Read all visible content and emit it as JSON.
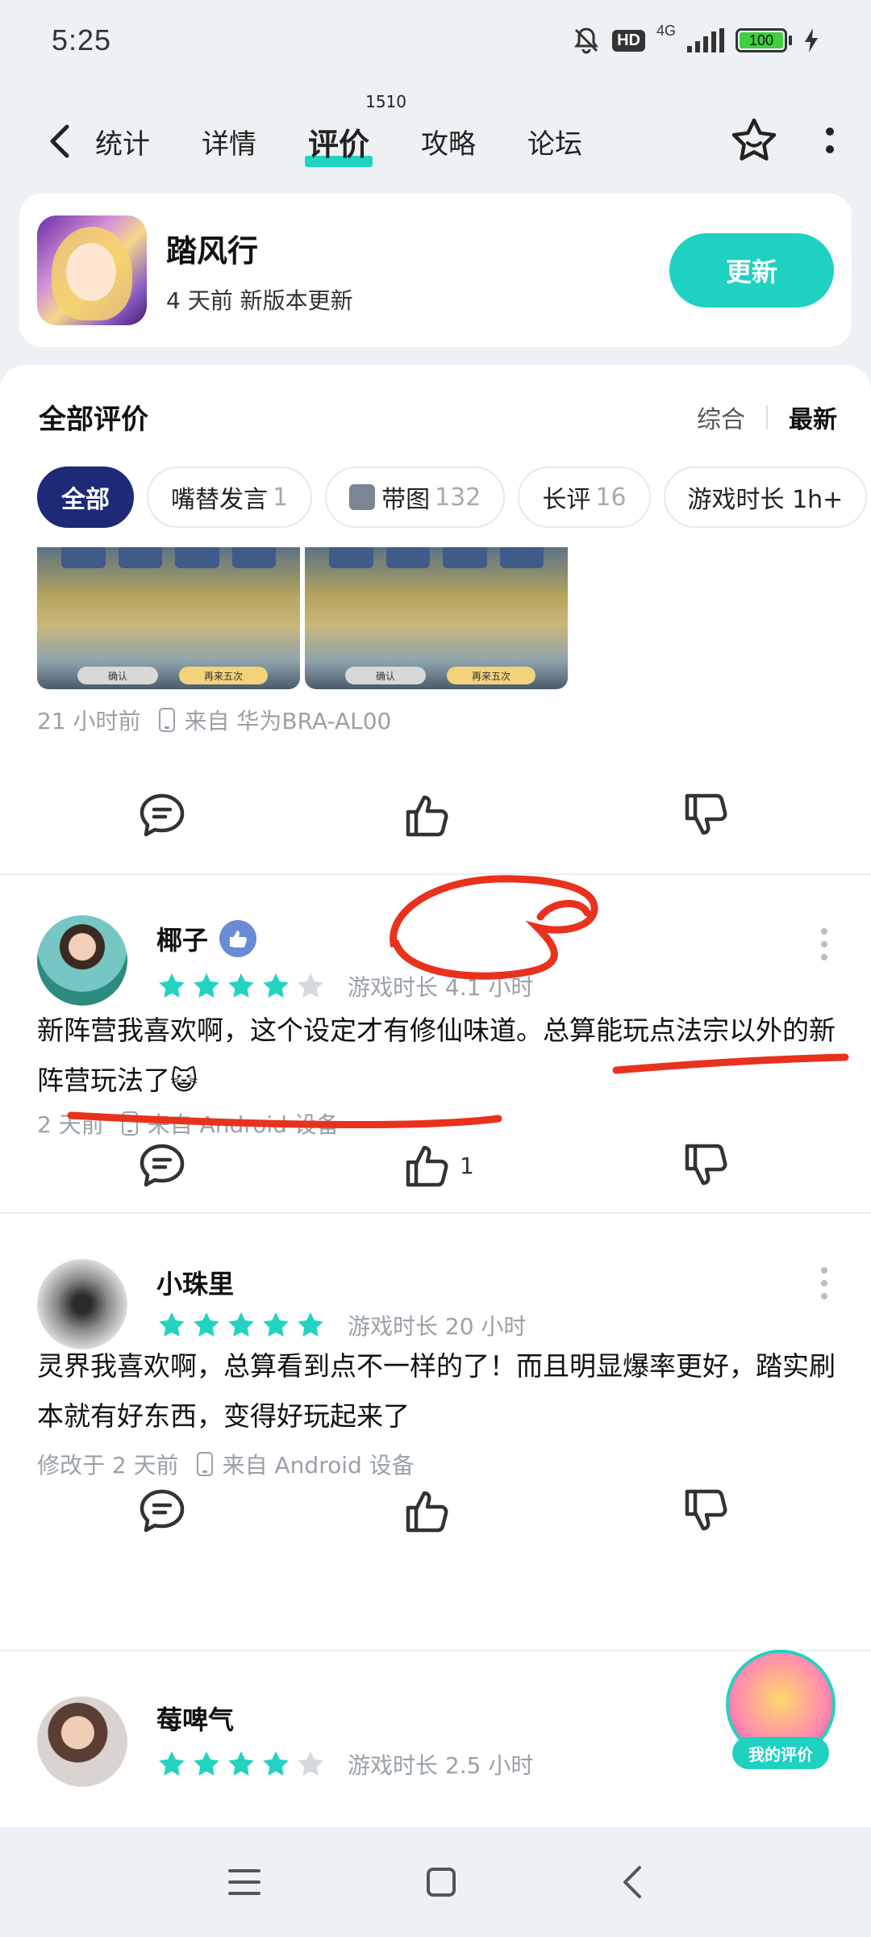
{
  "status_bar": {
    "time": "5:25",
    "hd_label": "HD",
    "network": "4G",
    "battery": "100"
  },
  "nav": {
    "tabs": [
      {
        "label": "统计"
      },
      {
        "label": "详情"
      },
      {
        "label": "评价",
        "count": "1510",
        "active": true
      },
      {
        "label": "攻略"
      },
      {
        "label": "论坛"
      }
    ]
  },
  "app": {
    "name": "踏风行",
    "subtitle": "4 天前 新版本更新",
    "update_label": "更新"
  },
  "list": {
    "title": "全部评价",
    "sort_options": [
      "综合",
      "最新"
    ],
    "sort_active": "最新",
    "filters": [
      {
        "label": "全部",
        "count": ""
      },
      {
        "label": "嘴替发言",
        "count": "1"
      },
      {
        "label": "带图",
        "count": "132"
      },
      {
        "label": "长评",
        "count": "16"
      },
      {
        "label": "游戏时长 1h+",
        "count": ""
      }
    ]
  },
  "partial_review": {
    "shot_buttons": [
      "确认",
      "再来五次"
    ],
    "time": "21 小时前",
    "device": "来自 华为BRA-AL00"
  },
  "reviews": [
    {
      "name": "椰子",
      "stars": 4,
      "playtime": "游戏时长 4.1 小时",
      "text": "新阵营我喜欢啊，这个设定才有修仙味道。总算能玩点法宗以外的新阵营玩法了😺",
      "time": "2 天前",
      "device": "来自 Android 设备",
      "likes": "1"
    },
    {
      "name": "小珠里",
      "stars": 5,
      "playtime": "游戏时长 20 小时",
      "text": "灵界我喜欢啊，总算看到点不一样的了！而且明显爆率更好，踏实刷本就有好东西，变得好玩起来了",
      "time": "修改于 2 天前",
      "device": "来自 Android 设备",
      "likes": ""
    },
    {
      "name": "莓啤气",
      "stars": 4,
      "playtime": "游戏时长 2.5 小时"
    }
  ],
  "fab": {
    "label": "我的评价"
  },
  "colors": {
    "accent": "#1fd1c1",
    "chip_active": "#1e2a78",
    "star": "#22d3c2",
    "annotation": "#e8321e"
  }
}
